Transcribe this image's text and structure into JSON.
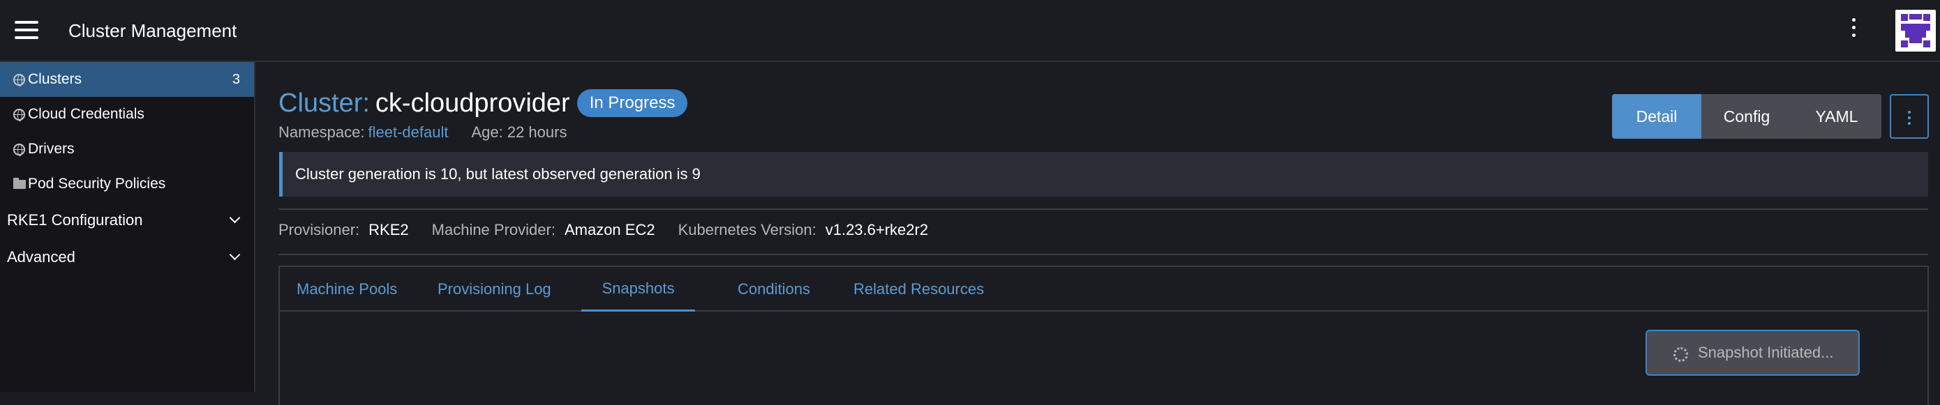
{
  "header": {
    "app_title": "Cluster Management",
    "menu_icon": "hamburger-menu-icon",
    "more_icon": "vertical-ellipsis-icon",
    "avatar_icon": "user-avatar-icon"
  },
  "sidebar": {
    "items": [
      {
        "label": "Clusters",
        "count": "3",
        "icon": "globe-icon",
        "active": true
      },
      {
        "label": "Cloud Credentials",
        "icon": "globe-icon"
      },
      {
        "label": "Drivers",
        "icon": "globe-icon"
      },
      {
        "label": "Pod Security Policies",
        "icon": "folder-icon"
      }
    ],
    "groups": [
      {
        "label": "RKE1 Configuration"
      },
      {
        "label": "Advanced"
      }
    ]
  },
  "main": {
    "title_prefix": "Cluster:",
    "title_name": "ck-cloudprovider",
    "state": "In Progress",
    "namespace_label": "Namespace:",
    "namespace_value": "fleet-default",
    "age": "Age: 22 hours",
    "view_modes": {
      "detail": "Detail",
      "config": "Config",
      "yaml": "YAML"
    },
    "banner": "Cluster generation is 10, but latest observed generation is 9",
    "info": {
      "provisioner_label": "Provisioner:",
      "provisioner_value": "RKE2",
      "machine_provider_label": "Machine Provider:",
      "machine_provider_value": "Amazon EC2",
      "k8s_version_label": "Kubernetes Version:",
      "k8s_version_value": "v1.23.6+rke2r2"
    },
    "tabs": [
      {
        "label": "Machine Pools"
      },
      {
        "label": "Provisioning Log"
      },
      {
        "label": "Snapshots",
        "active": true
      },
      {
        "label": "Conditions"
      },
      {
        "label": "Related Resources"
      }
    ],
    "snapshot_button": "Snapshot Initiated..."
  },
  "colors": {
    "accent": "#4f8fcb",
    "link": "#5b9bd5",
    "background": "#1b1c21",
    "sidebar_bg": "#141419",
    "active_nav": "#2c5a84"
  }
}
